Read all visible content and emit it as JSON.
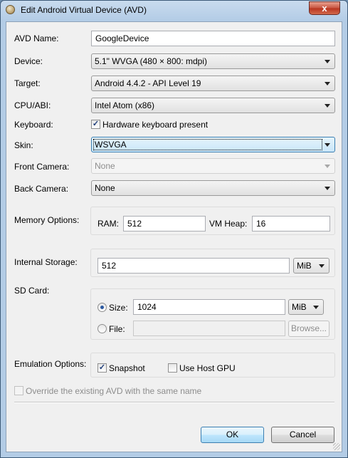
{
  "window": {
    "title": "Edit Android Virtual Device (AVD)",
    "close_glyph": "x"
  },
  "form": {
    "avd_name": {
      "label": "AVD Name:",
      "value": "GoogleDevice"
    },
    "device": {
      "label": "Device:",
      "value": "5.1\" WVGA (480 × 800: mdpi)"
    },
    "target": {
      "label": "Target:",
      "value": "Android 4.4.2 - API Level 19"
    },
    "cpu_abi": {
      "label": "CPU/ABI:",
      "value": "Intel Atom (x86)"
    },
    "keyboard": {
      "label": "Keyboard:",
      "checkbox_label": "Hardware keyboard present",
      "checked_glyph": "✓"
    },
    "skin": {
      "label": "Skin:",
      "value": "WSVGA"
    },
    "front_camera": {
      "label": "Front Camera:",
      "value": "None"
    },
    "back_camera": {
      "label": "Back Camera:",
      "value": "None"
    },
    "memory": {
      "label": "Memory Options:",
      "ram_label": "RAM:",
      "ram_value": "512",
      "vm_heap_label": "VM Heap:",
      "vm_heap_value": "16"
    },
    "internal_storage": {
      "label": "Internal Storage:",
      "value": "512",
      "unit": "MiB"
    },
    "sd_card": {
      "label": "SD Card:",
      "size_label": "Size:",
      "size_value": "1024",
      "size_unit": "MiB",
      "file_label": "File:",
      "file_value": "",
      "browse_label": "Browse..."
    },
    "emulation": {
      "label": "Emulation Options:",
      "snapshot_label": "Snapshot",
      "snapshot_glyph": "✓",
      "host_gpu_label": "Use Host GPU"
    },
    "override": {
      "label": "Override the existing AVD with the same name"
    }
  },
  "buttons": {
    "ok": "OK",
    "cancel": "Cancel"
  }
}
